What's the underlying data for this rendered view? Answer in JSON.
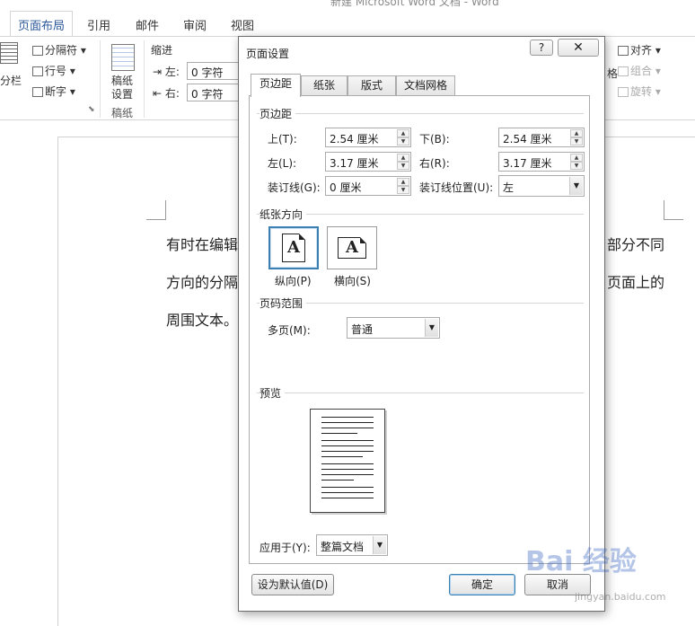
{
  "window": {
    "title": "新建 Microsoft Word 文档 - Word"
  },
  "ribbon": {
    "tabs": [
      {
        "label": "页面布局",
        "active": true
      },
      {
        "label": "引用"
      },
      {
        "label": "邮件"
      },
      {
        "label": "审阅"
      },
      {
        "label": "视图"
      }
    ],
    "columns_label": "分栏",
    "breaks_label": "分隔符",
    "line_numbers_label": "行号",
    "hyphenation_label": "断字",
    "manuscript_label": "稿纸\n设置",
    "manuscript_line1": "稿纸",
    "manuscript_line2": "设置",
    "manuscript_group": "稿纸",
    "indent_group": "缩进",
    "indent_left_label": "左:",
    "indent_left_value": "0 字符",
    "indent_right_label": "右:",
    "indent_right_value": "0 字符",
    "align_label": "对齐",
    "group_label": "组合",
    "rotate_label": "旋转",
    "arrange_fragment": "格"
  },
  "document": {
    "line1_left": "有时在编辑",
    "line1_right": "部分不同",
    "line2_left": "方向的分隔",
    "line2_right": "页面上的",
    "line3_left": "周围文本。"
  },
  "dialog": {
    "title": "页面设置",
    "help": "?",
    "close": "✕",
    "tabs": [
      "页边距",
      "纸张",
      "版式",
      "文档网格"
    ],
    "active_tab": "页边距",
    "margins": {
      "section": "页边距",
      "top_label": "上(T):",
      "top_value": "2.54 厘米",
      "bottom_label": "下(B):",
      "bottom_value": "2.54 厘米",
      "left_label": "左(L):",
      "left_value": "3.17 厘米",
      "right_label": "右(R):",
      "right_value": "3.17 厘米",
      "gutter_label": "装订线(G):",
      "gutter_value": "0 厘米",
      "gutter_pos_label": "装订线位置(U):",
      "gutter_pos_value": "左"
    },
    "orientation": {
      "section": "纸张方向",
      "portrait": "纵向(P)",
      "landscape": "横向(S)",
      "glyph": "A",
      "selected": "portrait"
    },
    "pages": {
      "section": "页码范围",
      "multiple_label": "多页(M):",
      "multiple_value": "普通"
    },
    "preview": {
      "section": "预览",
      "apply_label": "应用于(Y):",
      "apply_value": "整篇文档"
    },
    "buttons": {
      "default": "设为默认值(D)",
      "ok": "确定",
      "cancel": "取消"
    }
  },
  "watermark": {
    "text": "Bai 经验",
    "sub": "jingyan.baidu.com"
  }
}
